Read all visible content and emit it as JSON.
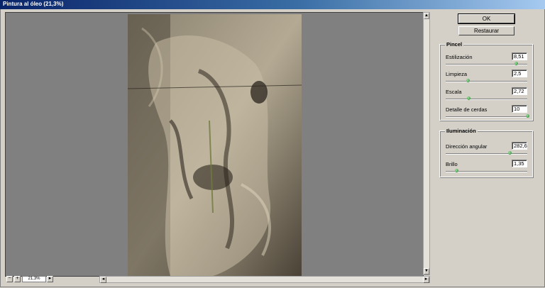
{
  "window": {
    "title": "Pintura al óleo (21,3%)"
  },
  "preview": {
    "zoom": "21,3%"
  },
  "buttons": {
    "ok": "OK",
    "reset": "Restaurar"
  },
  "pincel": {
    "title": "Pincel",
    "params": [
      {
        "label": "Estilización",
        "value": "8,51",
        "slider_fraction": 0.86
      },
      {
        "label": "Limpieza",
        "value": "2,5",
        "slider_fraction": 0.27
      },
      {
        "label": "Escala",
        "value": "2,72",
        "slider_fraction": 0.28
      },
      {
        "label": "Detalle de cerdas",
        "value": "10",
        "slider_fraction": 1.0
      }
    ]
  },
  "iluminacion": {
    "title": "Iluminación",
    "params": [
      {
        "label": "Dirección angular",
        "value": "282,6",
        "slider_fraction": 0.78
      },
      {
        "label": "Brillo",
        "value": "1,35",
        "slider_fraction": 0.13
      }
    ]
  },
  "colors": {
    "titlebar_start": "#0a246a",
    "slider_knob": "#2e9a3a",
    "canvas_bg": "#808080"
  }
}
